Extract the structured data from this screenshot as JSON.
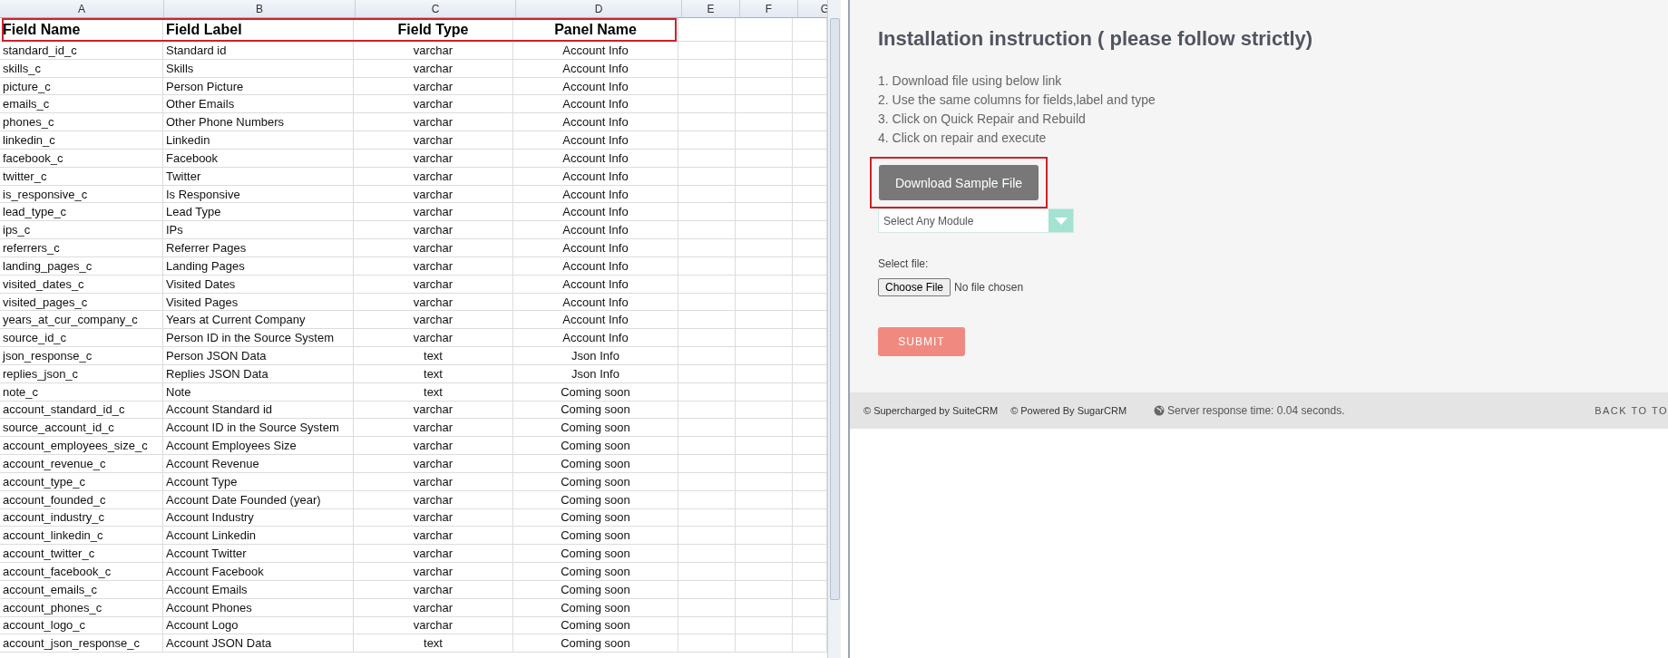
{
  "spreadsheet": {
    "column_letters": [
      "A",
      "B",
      "C",
      "D",
      "E",
      "F",
      "G"
    ],
    "header_row": {
      "highlighted": true,
      "cells": [
        "Field Name",
        "Field Label",
        "Field Type",
        "Panel Name"
      ]
    },
    "rows": [
      {
        "field_name": "standard_id_c",
        "field_label": "Standard id",
        "field_type": "varchar",
        "panel_name": "Account Info"
      },
      {
        "field_name": "skills_c",
        "field_label": "Skills",
        "field_type": "varchar",
        "panel_name": "Account Info"
      },
      {
        "field_name": "picture_c",
        "field_label": "Person Picture",
        "field_type": "varchar",
        "panel_name": "Account Info"
      },
      {
        "field_name": "emails_c",
        "field_label": "Other Emails",
        "field_type": "varchar",
        "panel_name": "Account Info"
      },
      {
        "field_name": "phones_c",
        "field_label": "Other Phone Numbers",
        "field_type": "varchar",
        "panel_name": "Account Info"
      },
      {
        "field_name": "linkedin_c",
        "field_label": "Linkedin",
        "field_type": "varchar",
        "panel_name": "Account Info"
      },
      {
        "field_name": "facebook_c",
        "field_label": "Facebook",
        "field_type": "varchar",
        "panel_name": "Account Info"
      },
      {
        "field_name": "twitter_c",
        "field_label": "Twitter",
        "field_type": "varchar",
        "panel_name": "Account Info"
      },
      {
        "field_name": "is_responsive_c",
        "field_label": "Is Responsive",
        "field_type": "varchar",
        "panel_name": "Account Info"
      },
      {
        "field_name": "lead_type_c",
        "field_label": "Lead Type",
        "field_type": "varchar",
        "panel_name": "Account Info"
      },
      {
        "field_name": "ips_c",
        "field_label": "IPs",
        "field_type": "varchar",
        "panel_name": "Account Info"
      },
      {
        "field_name": "referrers_c",
        "field_label": "Referrer Pages",
        "field_type": "varchar",
        "panel_name": "Account Info"
      },
      {
        "field_name": "landing_pages_c",
        "field_label": "Landing Pages",
        "field_type": "varchar",
        "panel_name": "Account Info"
      },
      {
        "field_name": "visited_dates_c",
        "field_label": "Visited Dates",
        "field_type": "varchar",
        "panel_name": "Account Info"
      },
      {
        "field_name": "visited_pages_c",
        "field_label": "Visited Pages",
        "field_type": "varchar",
        "panel_name": "Account Info"
      },
      {
        "field_name": "years_at_cur_company_c",
        "field_label": "Years at Current Company",
        "field_type": "varchar",
        "panel_name": "Account Info"
      },
      {
        "field_name": "source_id_c",
        "field_label": "Person ID in the Source System",
        "field_type": "varchar",
        "panel_name": "Account Info"
      },
      {
        "field_name": "json_response_c",
        "field_label": "Person JSON Data",
        "field_type": "text",
        "panel_name": "Json Info"
      },
      {
        "field_name": "replies_json_c",
        "field_label": "Replies JSON Data",
        "field_type": "text",
        "panel_name": "Json Info"
      },
      {
        "field_name": "note_c",
        "field_label": "Note",
        "field_type": "text",
        "panel_name": "Coming soon"
      },
      {
        "field_name": "account_standard_id_c",
        "field_label": "Account Standard id",
        "field_type": "varchar",
        "panel_name": "Coming soon"
      },
      {
        "field_name": "source_account_id_c",
        "field_label": "Account ID in the Source System",
        "field_type": "varchar",
        "panel_name": "Coming soon"
      },
      {
        "field_name": "account_employees_size_c",
        "field_label": "Account Employees Size",
        "field_type": "varchar",
        "panel_name": "Coming soon"
      },
      {
        "field_name": "account_revenue_c",
        "field_label": "Account Revenue",
        "field_type": "varchar",
        "panel_name": "Coming soon"
      },
      {
        "field_name": "account_type_c",
        "field_label": "Account Type",
        "field_type": "varchar",
        "panel_name": "Coming soon"
      },
      {
        "field_name": "account_founded_c",
        "field_label": "Account Date Founded (year)",
        "field_type": "varchar",
        "panel_name": "Coming soon"
      },
      {
        "field_name": "account_industry_c",
        "field_label": "Account Industry",
        "field_type": "varchar",
        "panel_name": "Coming soon"
      },
      {
        "field_name": "account_linkedin_c",
        "field_label": "Account Linkedin",
        "field_type": "varchar",
        "panel_name": "Coming soon"
      },
      {
        "field_name": "account_twitter_c",
        "field_label": "Account Twitter",
        "field_type": "varchar",
        "panel_name": "Coming soon"
      },
      {
        "field_name": "account_facebook_c",
        "field_label": "Account Facebook",
        "field_type": "varchar",
        "panel_name": "Coming soon"
      },
      {
        "field_name": "account_emails_c",
        "field_label": "Account Emails",
        "field_type": "varchar",
        "panel_name": "Coming soon"
      },
      {
        "field_name": "account_phones_c",
        "field_label": "Account Phones",
        "field_type": "varchar",
        "panel_name": "Coming soon"
      },
      {
        "field_name": "account_logo_c",
        "field_label": "Account Logo",
        "field_type": "varchar",
        "panel_name": "Coming soon"
      },
      {
        "field_name": "account_json_response_c",
        "field_label": "Account JSON Data",
        "field_type": "text",
        "panel_name": "Coming soon"
      }
    ]
  },
  "installer": {
    "title": "Installation instruction ( please follow strictly)",
    "steps": [
      "1. Download file using below link",
      "2. Use the same columns for fields,label and type",
      "3. Click on Quick Repair and Rebuild",
      "4. Click on repair and execute"
    ],
    "download_button": {
      "label": "Download Sample File",
      "highlighted": true
    },
    "module_select": {
      "placeholder": "Select Any Module"
    },
    "file_label": "Select file:",
    "choose_file_button": "Choose File",
    "file_status": "No file chosen",
    "submit_button": "SUBMIT"
  },
  "footer": {
    "credits": [
      "© Supercharged by SuiteCRM",
      "© Powered By SugarCRM"
    ],
    "response_time": "Server response time: 0.04 seconds.",
    "back_to_top": "BACK TO TO"
  }
}
